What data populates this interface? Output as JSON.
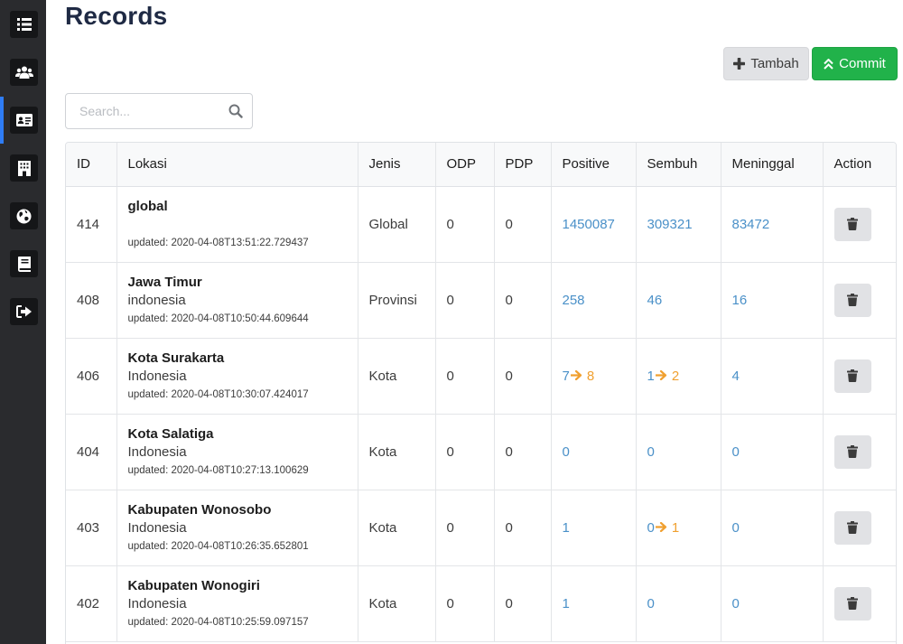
{
  "page": {
    "title": "Records"
  },
  "sidebar": {
    "items": [
      {
        "icon": "list-icon"
      },
      {
        "icon": "users-icon"
      },
      {
        "icon": "id-card-icon",
        "active": true
      },
      {
        "icon": "building-icon"
      },
      {
        "icon": "globe-icon"
      },
      {
        "icon": "book-icon"
      },
      {
        "icon": "sign-out-icon"
      }
    ],
    "accent": "#2f7df6"
  },
  "toolbar": {
    "tambah_label": "Tambah",
    "commit_label": "Commit",
    "commit_color": "#21b24a"
  },
  "search": {
    "placeholder": "Search...",
    "value": ""
  },
  "table": {
    "headers": [
      "ID",
      "Lokasi",
      "Jenis",
      "ODP",
      "PDP",
      "Positive",
      "Sembuh",
      "Meninggal",
      "Action"
    ],
    "rows": [
      {
        "id": "414",
        "name": "global",
        "country": "",
        "updated": "updated: 2020-04-08T13:51:22.729437",
        "jenis": "Global",
        "odp": "0",
        "pdp": "0",
        "positive": {
          "value": "1450087"
        },
        "sembuh": {
          "value": "309321"
        },
        "meninggal": {
          "value": "83472"
        }
      },
      {
        "id": "408",
        "name": "Jawa Timur",
        "country": "indonesia",
        "updated": "updated: 2020-04-08T10:50:44.609644",
        "jenis": "Provinsi",
        "odp": "0",
        "pdp": "0",
        "positive": {
          "value": "258"
        },
        "sembuh": {
          "value": "46"
        },
        "meninggal": {
          "value": "16"
        }
      },
      {
        "id": "406",
        "name": "Kota Surakarta",
        "country": "Indonesia",
        "updated": "updated: 2020-04-08T10:30:07.424017",
        "jenis": "Kota",
        "odp": "0",
        "pdp": "0",
        "positive": {
          "value": "7",
          "new": "8"
        },
        "sembuh": {
          "value": "1",
          "new": "2"
        },
        "meninggal": {
          "value": "4"
        }
      },
      {
        "id": "404",
        "name": "Kota Salatiga",
        "country": "Indonesia",
        "updated": "updated: 2020-04-08T10:27:13.100629",
        "jenis": "Kota",
        "odp": "0",
        "pdp": "0",
        "positive": {
          "value": "0"
        },
        "sembuh": {
          "value": "0"
        },
        "meninggal": {
          "value": "0"
        }
      },
      {
        "id": "403",
        "name": "Kabupaten Wonosobo",
        "country": "Indonesia",
        "updated": "updated: 2020-04-08T10:26:35.652801",
        "jenis": "Kota",
        "odp": "0",
        "pdp": "0",
        "positive": {
          "value": "1"
        },
        "sembuh": {
          "value": "0",
          "new": "1"
        },
        "meninggal": {
          "value": "0"
        }
      },
      {
        "id": "402",
        "name": "Kabupaten Wonogiri",
        "country": "Indonesia",
        "updated": "updated: 2020-04-08T10:25:59.097157",
        "jenis": "Kota",
        "odp": "0",
        "pdp": "0",
        "positive": {
          "value": "1"
        },
        "sembuh": {
          "value": "0"
        },
        "meninggal": {
          "value": "0"
        }
      }
    ]
  },
  "colors": {
    "link": "#4a90c8",
    "changed": "#f0a030"
  }
}
